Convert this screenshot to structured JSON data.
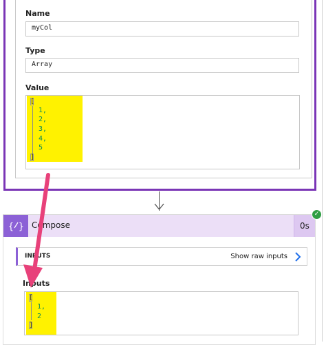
{
  "variable": {
    "name_label": "Name",
    "name_value": "myCol",
    "type_label": "Type",
    "type_value": "Array",
    "value_label": "Value",
    "value_code": {
      "open": "[",
      "items": [
        "1,",
        "2,",
        "3,",
        "4,",
        "5"
      ],
      "close": "]"
    }
  },
  "compose": {
    "icon": "{∕}",
    "title": "Compose",
    "duration": "0s",
    "status_icon": "check-icon",
    "inputs_section_title": "INPUTS",
    "show_raw_label": "Show raw inputs",
    "inputs_label": "Inputs",
    "inputs_code": {
      "open": "[",
      "items": [
        "1,",
        "2"
      ],
      "close": "]"
    }
  },
  "colors": {
    "card_border": "#7a35b6",
    "compose_header": "#ecdff7",
    "compose_icon_bg": "#8c61d6",
    "highlight": "#fff200",
    "annotation_arrow": "#e8417a",
    "success": "#2f9e44"
  }
}
